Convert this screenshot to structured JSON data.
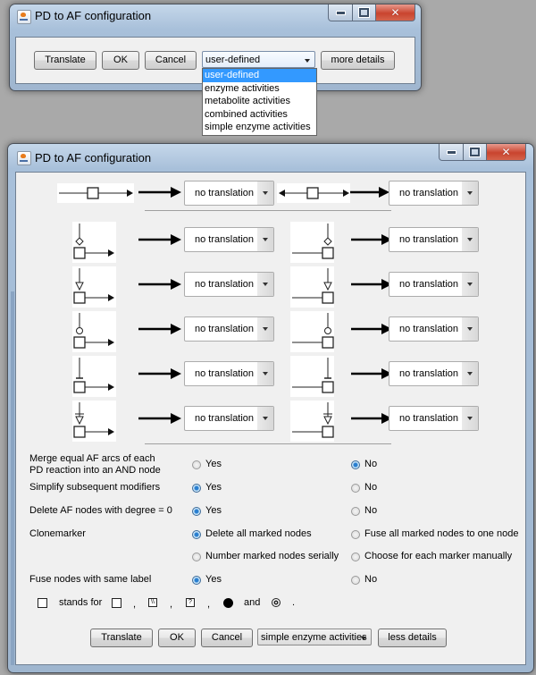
{
  "top_window": {
    "title": "PD to AF configuration",
    "buttons": {
      "translate": "Translate",
      "ok": "OK",
      "cancel": "Cancel",
      "more_details": "more details"
    },
    "preset_combo": {
      "selected": "user-defined",
      "options": [
        "user-defined",
        "enzyme activities",
        "metabolite activities",
        "combined activities",
        "simple enzyme activities"
      ],
      "highlighted_index": 0,
      "expanded": true
    }
  },
  "main_window": {
    "title": "PD to AF configuration",
    "translation_rows": [
      {
        "left_glyph": "consumption-production-arc",
        "left_value": "no translation",
        "right_glyph": "reversible-arc",
        "right_value": "no translation"
      },
      {
        "left_glyph": "modulation-arc",
        "left_value": "no translation",
        "right_glyph": "modulation-arc",
        "right_value": "no translation"
      },
      {
        "left_glyph": "stimulation-arc",
        "left_value": "no translation",
        "right_glyph": "stimulation-arc",
        "right_value": "no translation"
      },
      {
        "left_glyph": "catalysis-arc",
        "left_value": "no translation",
        "right_glyph": "catalysis-arc",
        "right_value": "no translation"
      },
      {
        "left_glyph": "inhibition-arc",
        "left_value": "no translation",
        "right_glyph": "inhibition-arc",
        "right_value": "no translation"
      },
      {
        "left_glyph": "necessary-stimulation-arc",
        "left_value": "no translation",
        "right_glyph": "necessary-stimulation-arc",
        "right_value": "no translation"
      }
    ],
    "options": [
      {
        "label": "Merge equal AF arcs of each PD reaction into an AND node",
        "choices": [
          {
            "label": "Yes",
            "checked": false
          },
          {
            "label": "No",
            "checked": true
          }
        ]
      },
      {
        "label": "Simplify subsequent modifiers",
        "choices": [
          {
            "label": "Yes",
            "checked": true
          },
          {
            "label": "No",
            "checked": false
          }
        ]
      },
      {
        "label": "Delete AF nodes with degree = 0",
        "choices": [
          {
            "label": "Yes",
            "checked": true
          },
          {
            "label": "No",
            "checked": false
          }
        ]
      },
      {
        "label": "Clonemarker",
        "choices": [
          {
            "label": "Delete all marked nodes",
            "checked": true
          },
          {
            "label": "Fuse all marked nodes to one node",
            "checked": false
          },
          {
            "label": "Number marked nodes serially",
            "checked": false
          },
          {
            "label": "Choose for each marker manually",
            "checked": false
          }
        ]
      },
      {
        "label": "Fuse nodes with same label",
        "choices": [
          {
            "label": "Yes",
            "checked": true
          },
          {
            "label": "No",
            "checked": false
          }
        ]
      }
    ],
    "legend": {
      "stands_for": "stands for",
      "comma": ",",
      "and": "and",
      "period": ".",
      "symbols": [
        "square-node-icon",
        "perturbation-node-icon",
        "unknown-node-icon",
        "filled-circle-icon",
        "double-circle-icon"
      ]
    },
    "buttons": {
      "translate": "Translate",
      "ok": "OK",
      "cancel": "Cancel",
      "less_details": "less details"
    },
    "preset_combo": {
      "selected": "simple enzyme activities"
    }
  }
}
